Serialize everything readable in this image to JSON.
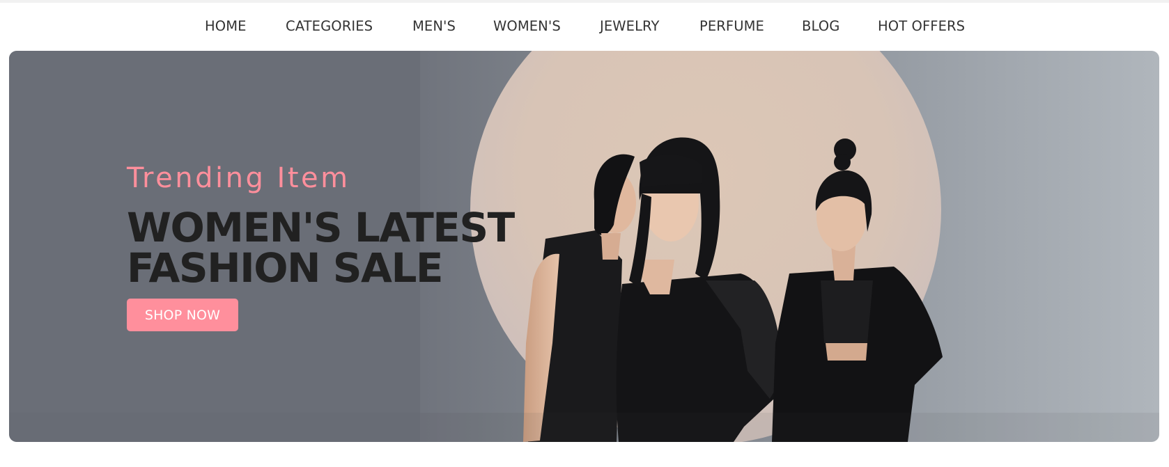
{
  "nav": {
    "items": [
      {
        "label": "HOME"
      },
      {
        "label": "CATEGORIES"
      },
      {
        "label": "MEN'S"
      },
      {
        "label": "WOMEN'S"
      },
      {
        "label": "JEWELRY"
      },
      {
        "label": "PERFUME"
      },
      {
        "label": "BLOG"
      },
      {
        "label": "HOT OFFERS"
      }
    ]
  },
  "banner": {
    "subtitle": "Trending Item",
    "headline": "WOMEN'S LATEST FASHION SALE",
    "cta_label": "SHOP NOW",
    "image": "three women in black fashion outfits in front of a beige circle"
  },
  "colors": {
    "accent": "#ff8f9c",
    "headline": "#212121",
    "nav_text": "#333333",
    "banner_bg": "#70747d"
  }
}
